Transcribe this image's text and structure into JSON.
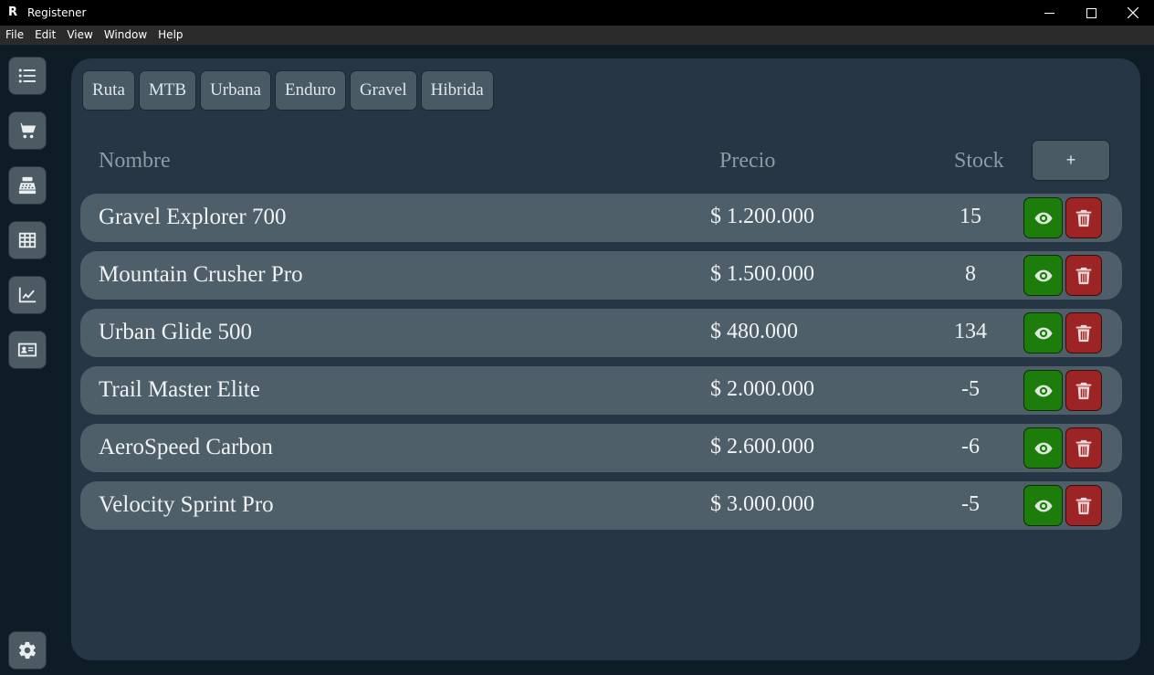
{
  "window": {
    "title": "Registener"
  },
  "menu": [
    "File",
    "Edit",
    "View",
    "Window",
    "Help"
  ],
  "sidebar": {
    "items": [
      {
        "icon": "list-icon"
      },
      {
        "icon": "cart-icon"
      },
      {
        "icon": "cash-register-icon"
      },
      {
        "icon": "grid-icon"
      },
      {
        "icon": "chart-line-icon"
      },
      {
        "icon": "id-card-icon"
      }
    ],
    "settings_icon": "gear-icon"
  },
  "filters": [
    "Ruta",
    "MTB",
    "Urbana",
    "Enduro",
    "Gravel",
    "Hibrida"
  ],
  "table": {
    "headers": {
      "name": "Nombre",
      "price": "Precio",
      "stock": "Stock"
    },
    "add_label": "+",
    "rows": [
      {
        "name": "Gravel Explorer 700",
        "price": "$ 1.200.000",
        "stock": "15"
      },
      {
        "name": "Mountain Crusher Pro",
        "price": "$ 1.500.000",
        "stock": "8"
      },
      {
        "name": "Urban Glide 500",
        "price": "$ 480.000",
        "stock": "134"
      },
      {
        "name": "Trail Master Elite",
        "price": "$ 2.000.000",
        "stock": "-5"
      },
      {
        "name": "AeroSpeed Carbon",
        "price": "$ 2.600.000",
        "stock": "-6"
      },
      {
        "name": "Velocity Sprint Pro",
        "price": "$ 3.000.000",
        "stock": "-5"
      }
    ]
  },
  "colors": {
    "panel": "#263645",
    "row": "#4f5f69",
    "view": "#1c7d0a",
    "delete": "#9c2424"
  }
}
